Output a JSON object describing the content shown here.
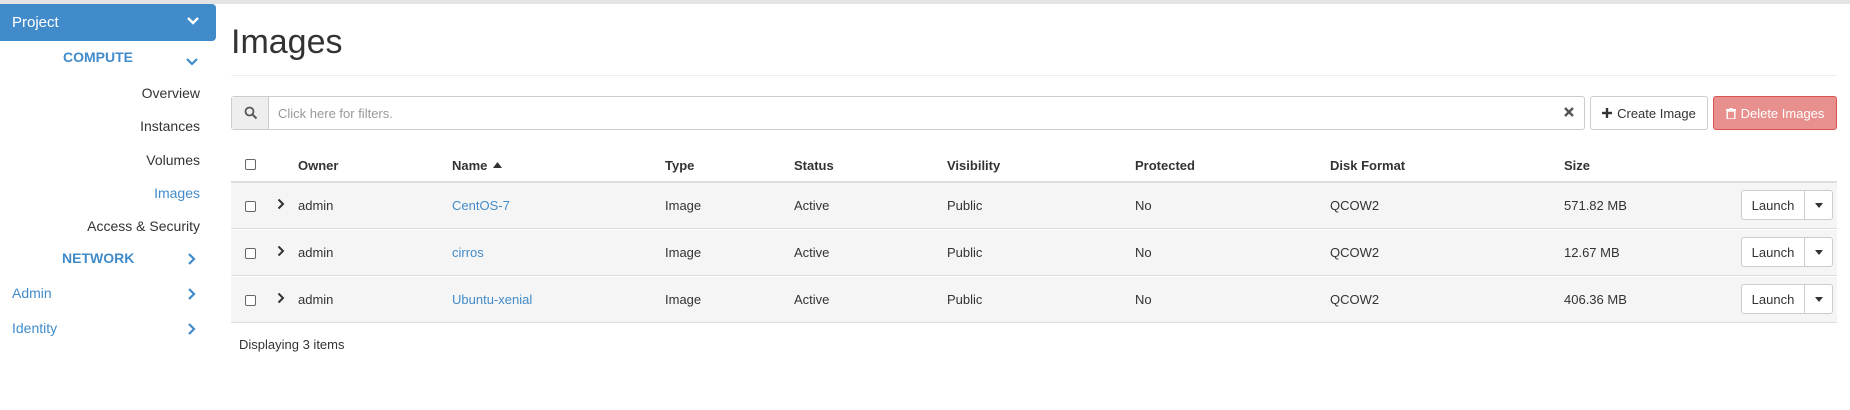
{
  "sidebar": {
    "project_label": "Project",
    "compute_label": "COMPUTE",
    "compute_items": [
      {
        "label": "Overview"
      },
      {
        "label": "Instances"
      },
      {
        "label": "Volumes"
      },
      {
        "label": "Images",
        "active": true
      },
      {
        "label": "Access & Security"
      }
    ],
    "network_label": "NETWORK",
    "admin_label": "Admin",
    "identity_label": "Identity"
  },
  "page": {
    "title": "Images"
  },
  "toolbar": {
    "filter_placeholder": "Click here for filters.",
    "create_label": "Create Image",
    "delete_label": "Delete Images"
  },
  "table": {
    "columns": {
      "owner": "Owner",
      "name": "Name",
      "type": "Type",
      "status": "Status",
      "visibility": "Visibility",
      "protected": "Protected",
      "disk_format": "Disk Format",
      "size": "Size"
    },
    "rows": [
      {
        "owner": "admin",
        "name": "CentOS-7",
        "type": "Image",
        "status": "Active",
        "visibility": "Public",
        "protected": "No",
        "disk_format": "QCOW2",
        "size": "571.82 MB",
        "action": "Launch"
      },
      {
        "owner": "admin",
        "name": "cirros",
        "type": "Image",
        "status": "Active",
        "visibility": "Public",
        "protected": "No",
        "disk_format": "QCOW2",
        "size": "12.67 MB",
        "action": "Launch"
      },
      {
        "owner": "admin",
        "name": "Ubuntu-xenial",
        "type": "Image",
        "status": "Active",
        "visibility": "Public",
        "protected": "No",
        "disk_format": "QCOW2",
        "size": "406.36 MB",
        "action": "Launch"
      }
    ],
    "footer": "Displaying 3 items"
  },
  "colors": {
    "accent": "#428bca",
    "danger_disabled": "#e8908d",
    "row_bg": "#f5f5f5"
  }
}
